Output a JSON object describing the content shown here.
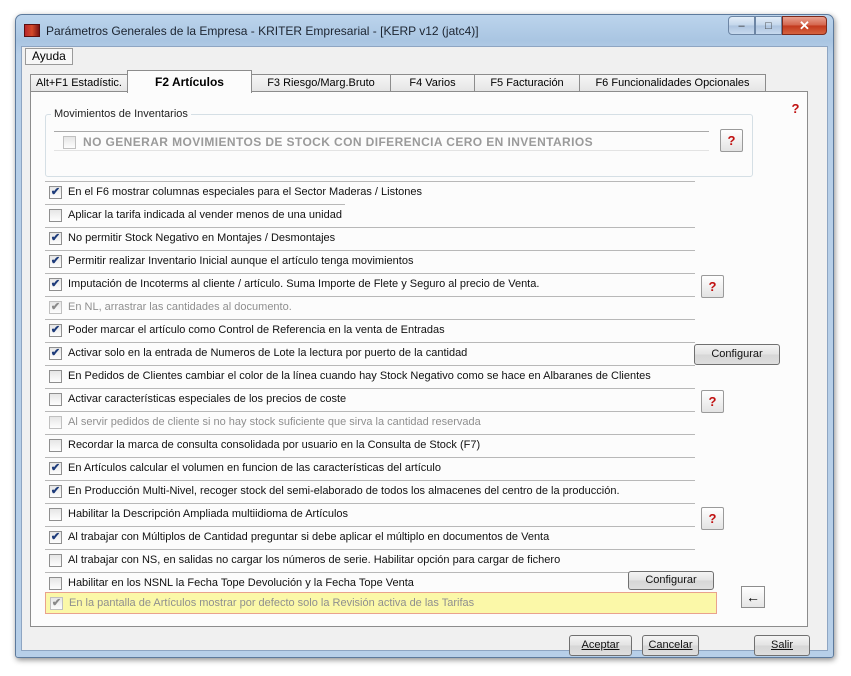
{
  "window": {
    "title": "Parámetros Generales de la Empresa - KRITER Empresarial - [KERP v12 (jatc4)]",
    "minimize": "–",
    "maximize": "□",
    "close": "✕"
  },
  "menu": {
    "help": "Ayuda"
  },
  "tabs": [
    "Alt+F1 Estadístic.",
    "F2 Artículos",
    "F3 Riesgo/Marg.Bruto",
    "F4 Varios",
    "F5 Facturación",
    "F6 Funcionalidades Opcionales"
  ],
  "active_tab": "F2 Artículos",
  "group": {
    "title": "Movimientos de Inventarios",
    "option": "NO GENERAR MOVIMIENTOS DE STOCK CON DIFERENCIA CERO EN INVENTARIOS",
    "checked": false
  },
  "help_glyph": "?",
  "options": [
    {
      "label": "En el F6 mostrar columnas especiales para el Sector Maderas / Listones",
      "checked": true,
      "disabled": false
    },
    {
      "label": "Aplicar la tarifa indicada al vender menos de una unidad",
      "checked": false,
      "disabled": false
    },
    {
      "label": "No permitir Stock Negativo en Montajes / Desmontajes",
      "checked": true,
      "disabled": false
    },
    {
      "label": "Permitir realizar Inventario Inicial aunque el artículo tenga movimientos",
      "checked": true,
      "disabled": false
    },
    {
      "label": "Imputación de Incoterms al cliente / artículo.  Suma Importe de Flete y Seguro al precio de Venta.",
      "checked": true,
      "disabled": false
    },
    {
      "label": "En NL, arrastrar las cantidades al documento.",
      "checked": true,
      "disabled": true
    },
    {
      "label": "Poder marcar el artículo como Control de Referencia en la venta de Entradas",
      "checked": true,
      "disabled": false
    },
    {
      "label": "Activar solo en la entrada de Numeros de Lote la lectura por puerto de la cantidad",
      "checked": true,
      "disabled": false
    },
    {
      "label": "En Pedidos de Clientes cambiar el color de la línea cuando hay Stock Negativo como se hace en Albaranes de Clientes",
      "checked": false,
      "disabled": false
    },
    {
      "label": "Activar características especiales de los precios de coste",
      "checked": false,
      "disabled": false
    },
    {
      "label": "Al servir pedidos de cliente si no hay stock suficiente que sirva la cantidad reservada",
      "checked": false,
      "disabled": true
    },
    {
      "label": "Recordar la marca de consulta consolidada por usuario en la Consulta de Stock (F7)",
      "checked": false,
      "disabled": false
    },
    {
      "label": "En Artículos calcular el volumen en funcion de las características del artículo",
      "checked": true,
      "disabled": false
    },
    {
      "label": "En Producción Multi-Nivel, recoger stock del semi-elaborado de todos los almacenes del centro de la producción.",
      "checked": true,
      "disabled": false
    },
    {
      "label": "Habilitar la Descripción Ampliada multiidioma de Artículos",
      "checked": false,
      "disabled": false
    },
    {
      "label": "Al trabajar con Múltiplos de Cantidad preguntar si debe aplicar el múltiplo en documentos de Venta",
      "checked": true,
      "disabled": false
    },
    {
      "label": "Al trabajar con NS, en salidas no cargar los números de serie. Habilitar opción para cargar de fichero",
      "checked": false,
      "disabled": false
    },
    {
      "label": "Habilitar en los NSNL la Fecha Tope Devolución y la Fecha Tope Venta",
      "checked": false,
      "disabled": false
    },
    {
      "label": "En la pantalla de Artículos mostrar por defecto solo la Revisión activa de las Tarifas",
      "checked": true,
      "disabled": true
    }
  ],
  "buttons": {
    "configurar": "Configurar",
    "aceptar": "Aceptar",
    "cancelar": "Cancelar",
    "salir": "Salir",
    "back_arrow": "←"
  }
}
